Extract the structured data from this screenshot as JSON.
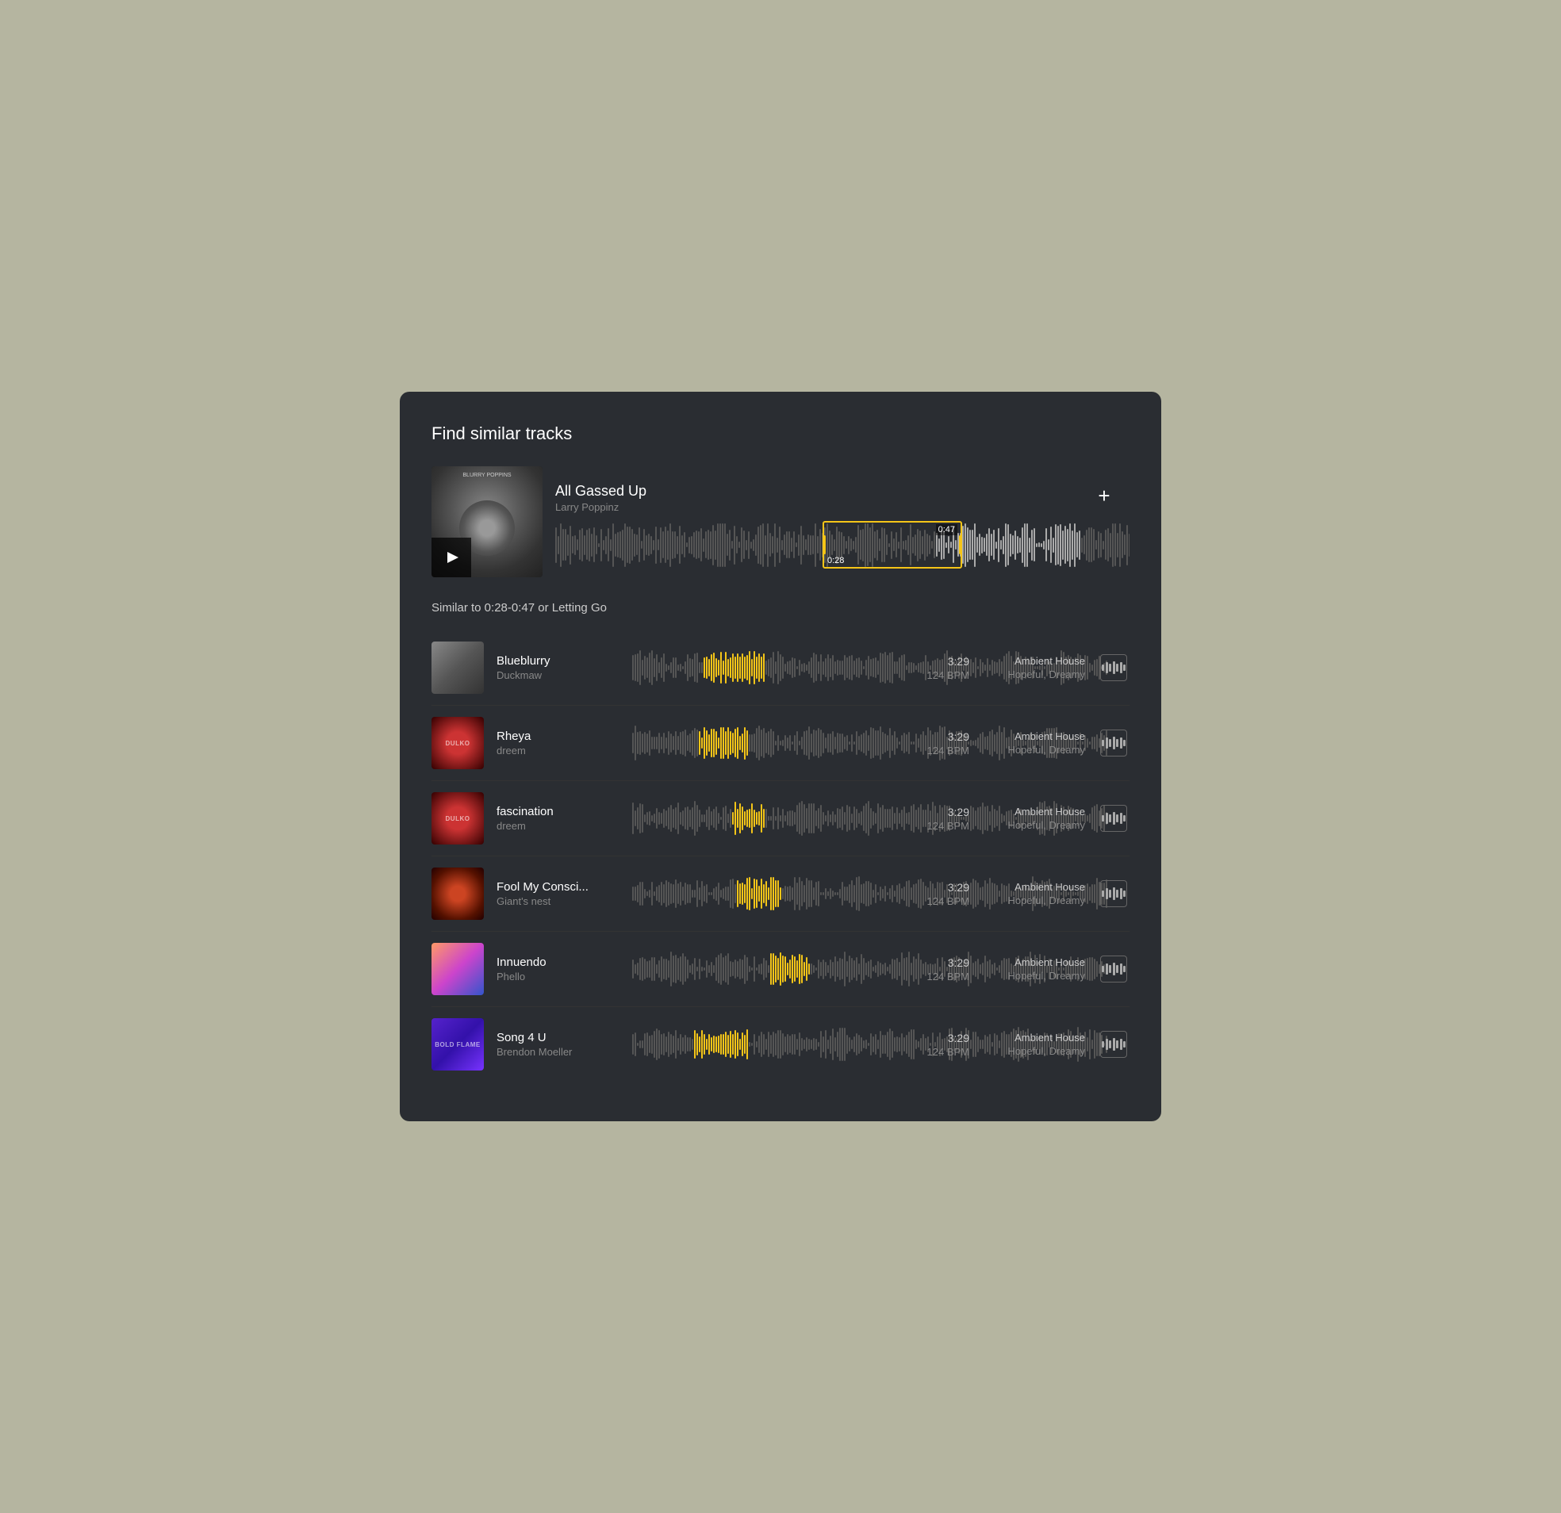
{
  "panel": {
    "title": "Find similar tracks",
    "add_button_label": "+"
  },
  "source_track": {
    "name": "All Gassed Up",
    "artist": "Larry Poppinz",
    "selection_start": "0:28",
    "selection_end": "0:47",
    "album_label": "BLURRY POPPINS"
  },
  "similar_label": "Similar to 0:28-0:47 or Letting Go",
  "tracks": [
    {
      "id": 1,
      "title": "Blueblurry",
      "artist": "Duckmaw",
      "duration": "3:29",
      "bpm": "124 BPM",
      "genre": "Ambient House",
      "mood": "Hopeful, Dreamy",
      "thumb_class": "thumb-bg-1",
      "thumb_text": "",
      "highlight_start": 30,
      "highlight_end": 55
    },
    {
      "id": 2,
      "title": "Rheya",
      "artist": "dreem",
      "duration": "3:29",
      "bpm": "124 BPM",
      "genre": "Ambient House",
      "mood": "Hopeful, Dreamy",
      "thumb_class": "thumb-bg-2",
      "thumb_text": "DULKO",
      "highlight_start": 28,
      "highlight_end": 48
    },
    {
      "id": 3,
      "title": "fascination",
      "artist": "dreem",
      "duration": "3:29",
      "bpm": "124 BPM",
      "genre": "Ambient House",
      "mood": "Hopeful, Dreamy",
      "thumb_class": "thumb-bg-3",
      "thumb_text": "DULKO",
      "highlight_start": 42,
      "highlight_end": 55
    },
    {
      "id": 4,
      "title": "Fool My Consci...",
      "artist": "Giant's nest",
      "duration": "3:29",
      "bpm": "124 BPM",
      "genre": "Ambient House",
      "mood": "Hopeful, Dreamy",
      "thumb_class": "thumb-bg-4",
      "thumb_text": "",
      "highlight_start": 44,
      "highlight_end": 62
    },
    {
      "id": 5,
      "title": "Innuendo",
      "artist": "Phello",
      "duration": "3:29",
      "bpm": "124 BPM",
      "genre": "Ambient House",
      "mood": "Hopeful, Dreamy",
      "thumb_class": "thumb-bg-5",
      "thumb_text": "",
      "highlight_start": 58,
      "highlight_end": 74
    },
    {
      "id": 6,
      "title": "Song 4 U",
      "artist": "Brendon Moeller",
      "duration": "3:29",
      "bpm": "124 BPM",
      "genre": "Ambient House",
      "mood": "Hopeful, Dreamy",
      "thumb_class": "thumb-bg-6",
      "thumb_text": "BOLD FLAME",
      "highlight_start": 26,
      "highlight_end": 48
    }
  ]
}
